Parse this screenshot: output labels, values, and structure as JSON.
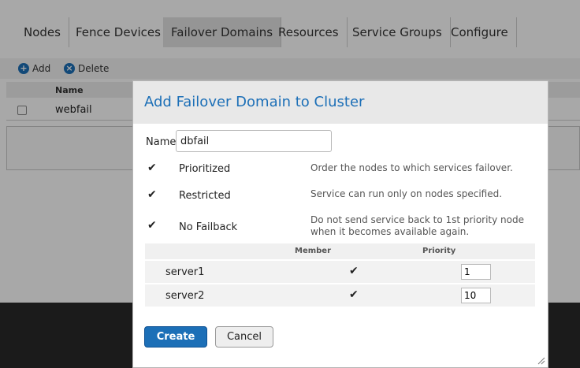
{
  "tabs": [
    {
      "label": "Nodes"
    },
    {
      "label": "Fence Devices"
    },
    {
      "label": "Failover Domains"
    },
    {
      "label": "Resources"
    },
    {
      "label": "Service Groups"
    },
    {
      "label": "Configure"
    }
  ],
  "toolbar": {
    "add_label": "Add",
    "delete_label": "Delete"
  },
  "list": {
    "header_name": "Name",
    "rows": [
      {
        "name": "webfail"
      }
    ]
  },
  "dialog": {
    "title": "Add Failover Domain to Cluster",
    "name_label": "Name",
    "name_value": "dbfail",
    "options": [
      {
        "label": "Prioritized",
        "checked": true,
        "description": "Order the nodes to which services failover."
      },
      {
        "label": "Restricted",
        "checked": true,
        "description": "Service can run only on nodes specified."
      },
      {
        "label": "No Failback",
        "checked": true,
        "description_line1": "Do not send service back to 1st priority node",
        "description_line2": "when it becomes available again."
      }
    ],
    "members_table": {
      "col_member": "Member",
      "col_priority": "Priority",
      "rows": [
        {
          "server": "server1",
          "member": true,
          "priority": "1"
        },
        {
          "server": "server2",
          "member": true,
          "priority": "10"
        }
      ]
    },
    "create_label": "Create",
    "cancel_label": "Cancel"
  },
  "colors": {
    "accent": "#1c6fb7",
    "overlay": "#000000"
  }
}
